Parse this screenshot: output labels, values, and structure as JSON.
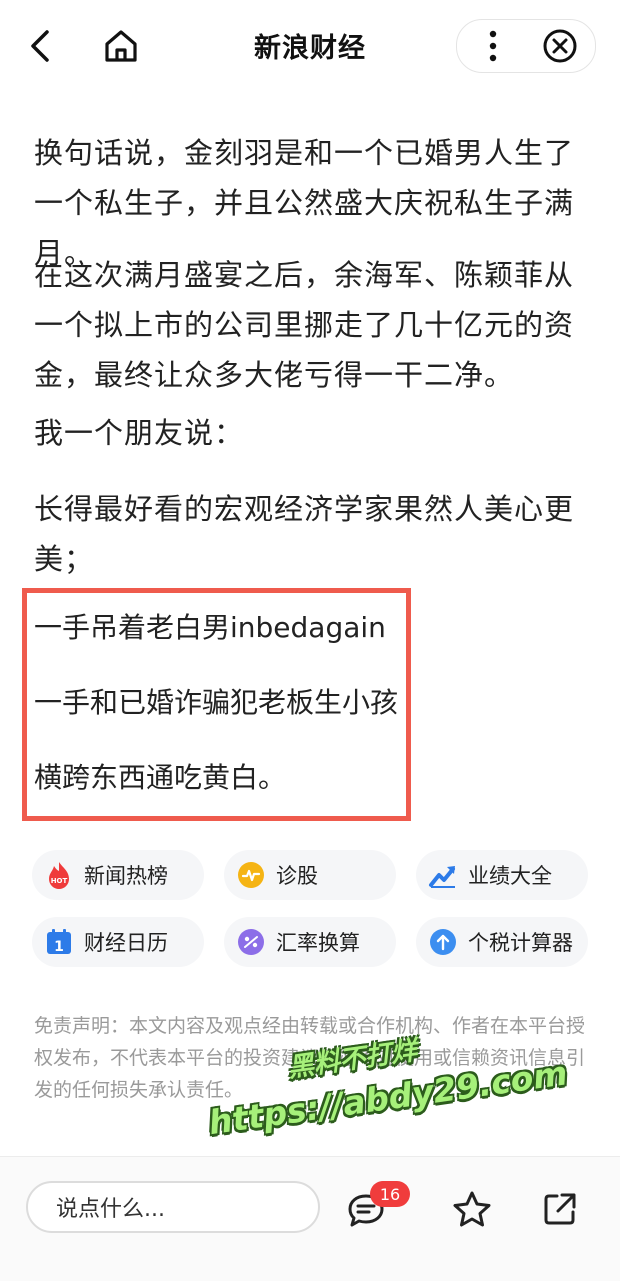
{
  "header": {
    "title": "新浪财经"
  },
  "article": {
    "cut_text": "短",
    "paragraphs": [
      "换句话说，金刻羽是和一个已婚男人生了一个私生子，并且公然盛大庆祝私生子满月。",
      "在这次满月盛宴之后，余海军、陈颖菲从一个拟上市的公司里挪走了几十亿元的资金，最终让众多大佬亏得一干二净。",
      "我一个朋友说：",
      "长得最好看的宏观经济学家果然人美心更美；"
    ],
    "highlight_lines": [
      "一手吊着老白男inbedagain",
      "一手和已婚诈骗犯老板生小孩",
      "横跨东西通吃黄白。"
    ]
  },
  "tools": [
    {
      "label": "新闻热榜",
      "icon": "hot-news-icon"
    },
    {
      "label": "诊股",
      "icon": "stock-pulse-icon"
    },
    {
      "label": "业绩大全",
      "icon": "trend-chart-icon"
    },
    {
      "label": "财经日历",
      "icon": "calendar-icon"
    },
    {
      "label": "汇率换算",
      "icon": "exchange-icon"
    },
    {
      "label": "个税计算器",
      "icon": "tax-calculator-icon"
    }
  ],
  "disclaimer": "免责声明：本文内容及观点经由转载或合作机构、作者在本平台授权发布，不代表本平台的投资建议，亦不对使用或信赖资讯信息引发的任何损失承认责任。",
  "watermark": {
    "line1": "黑料不打烊",
    "line2": "https://abdy29.com"
  },
  "bottom_bar": {
    "comment_placeholder": "说点什么...",
    "comment_count": "16"
  },
  "colors": {
    "highlight_border": "#ef5b4d",
    "badge": "#f03c3c",
    "watermark": "#a6f07a"
  }
}
